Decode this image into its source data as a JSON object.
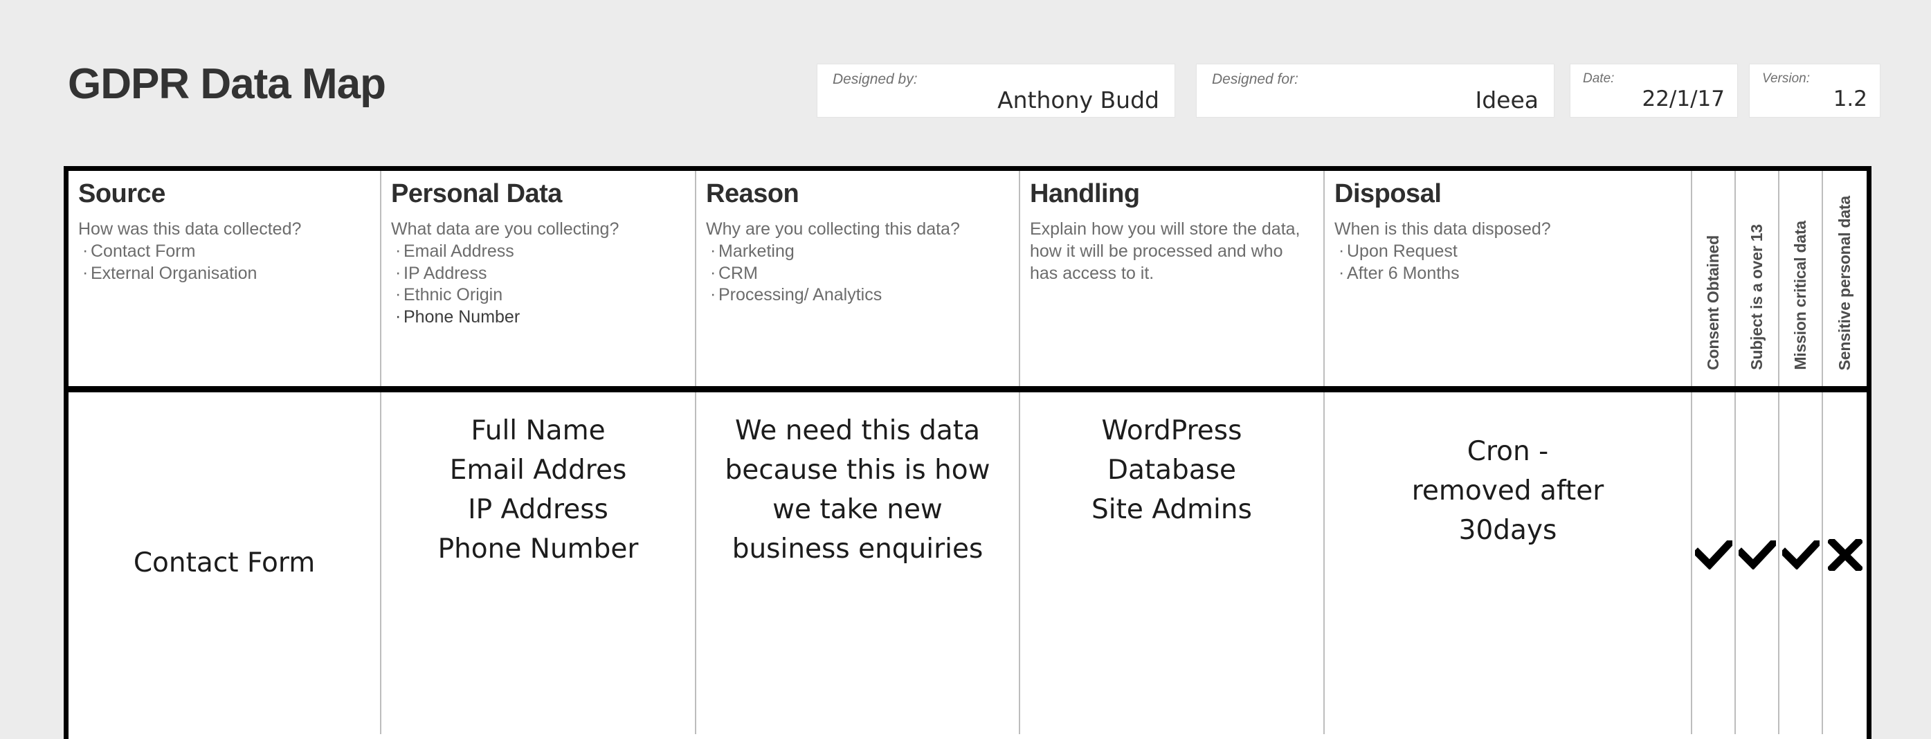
{
  "page": {
    "title": "GDPR Data Map",
    "background_color": "#ececec",
    "accent_color": "#000000"
  },
  "meta_fields": [
    {
      "label": "Designed by:",
      "value": "Anthony Budd"
    },
    {
      "label": "Designed for:",
      "value": "Ideea"
    },
    {
      "label": "Date:",
      "value": "22/1/17"
    },
    {
      "label": "Version:",
      "value": "1.2"
    }
  ],
  "table": {
    "columns": [
      {
        "title": "Source",
        "prompt": "How was this data collected?",
        "examples": [
          "Contact Form",
          "External Organisation"
        ],
        "emphasis_index": null
      },
      {
        "title": "Personal Data",
        "prompt": "What data are you collecting?",
        "examples": [
          "Email Address",
          "IP Address",
          "Ethnic Origin",
          "Phone Number"
        ],
        "emphasis_index": 3
      },
      {
        "title": "Reason",
        "prompt": "Why are you collecting this data?",
        "examples": [
          "Marketing",
          "CRM",
          "Processing/ Analytics"
        ],
        "emphasis_index": null
      },
      {
        "title": "Handling",
        "prompt": "Explain how you will store the data, how it will be processed and who has access to it.",
        "examples": [],
        "emphasis_index": null
      },
      {
        "title": "Disposal",
        "prompt": "When is this data disposed?",
        "examples": [
          "Upon Request",
          "After 6 Months"
        ],
        "emphasis_index": null
      }
    ],
    "flag_columns": [
      {
        "label": "Consent Obtained"
      },
      {
        "label": "Subject is a over 13"
      },
      {
        "label": "Mission critical data"
      },
      {
        "label": "Sensitive personal data"
      }
    ],
    "rows": [
      {
        "source": "Contact Form",
        "personal_data": "Full Name\nEmail Addres\nIP Address\nPhone Number",
        "reason": "We need this data because this is how we take new business enquiries",
        "handling": "WordPress\nDatabase\nSite Admins",
        "disposal": "Cron -\nremoved after\n30days",
        "flags": [
          "check",
          "check",
          "check",
          "cross"
        ]
      }
    ]
  }
}
